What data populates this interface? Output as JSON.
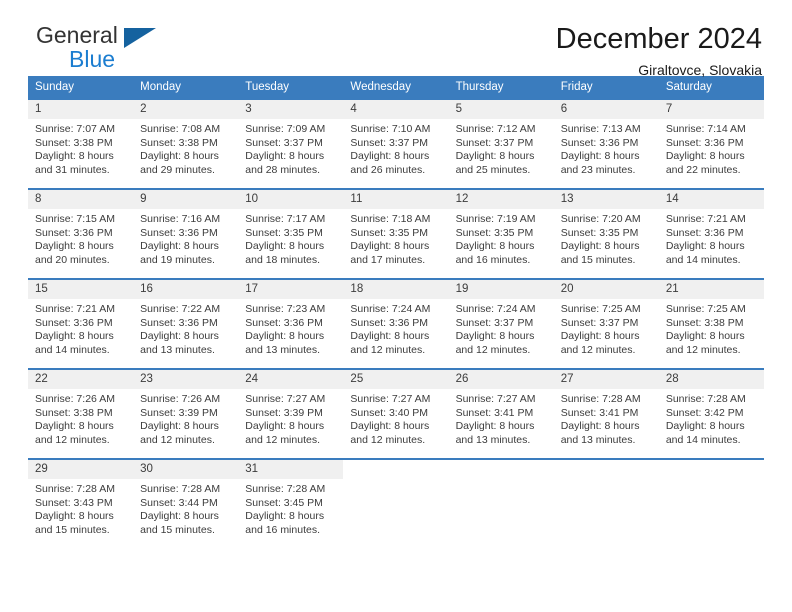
{
  "brand": {
    "name_top": "General",
    "name_bottom": "Blue",
    "mark": "triangle-logo"
  },
  "header": {
    "title": "December 2024",
    "subtitle": "Giraltovce, Slovakia"
  },
  "colors": {
    "header_blue": "#3a7cbe",
    "brand_blue": "#1b7dd0",
    "daynum_band": "#f0f0f0"
  },
  "weekday_headers": [
    "Sunday",
    "Monday",
    "Tuesday",
    "Wednesday",
    "Thursday",
    "Friday",
    "Saturday"
  ],
  "weeks": [
    [
      {
        "day": "1",
        "sunrise": "Sunrise: 7:07 AM",
        "sunset": "Sunset: 3:38 PM",
        "daylight_1": "Daylight: 8 hours",
        "daylight_2": "and 31 minutes."
      },
      {
        "day": "2",
        "sunrise": "Sunrise: 7:08 AM",
        "sunset": "Sunset: 3:38 PM",
        "daylight_1": "Daylight: 8 hours",
        "daylight_2": "and 29 minutes."
      },
      {
        "day": "3",
        "sunrise": "Sunrise: 7:09 AM",
        "sunset": "Sunset: 3:37 PM",
        "daylight_1": "Daylight: 8 hours",
        "daylight_2": "and 28 minutes."
      },
      {
        "day": "4",
        "sunrise": "Sunrise: 7:10 AM",
        "sunset": "Sunset: 3:37 PM",
        "daylight_1": "Daylight: 8 hours",
        "daylight_2": "and 26 minutes."
      },
      {
        "day": "5",
        "sunrise": "Sunrise: 7:12 AM",
        "sunset": "Sunset: 3:37 PM",
        "daylight_1": "Daylight: 8 hours",
        "daylight_2": "and 25 minutes."
      },
      {
        "day": "6",
        "sunrise": "Sunrise: 7:13 AM",
        "sunset": "Sunset: 3:36 PM",
        "daylight_1": "Daylight: 8 hours",
        "daylight_2": "and 23 minutes."
      },
      {
        "day": "7",
        "sunrise": "Sunrise: 7:14 AM",
        "sunset": "Sunset: 3:36 PM",
        "daylight_1": "Daylight: 8 hours",
        "daylight_2": "and 22 minutes."
      }
    ],
    [
      {
        "day": "8",
        "sunrise": "Sunrise: 7:15 AM",
        "sunset": "Sunset: 3:36 PM",
        "daylight_1": "Daylight: 8 hours",
        "daylight_2": "and 20 minutes."
      },
      {
        "day": "9",
        "sunrise": "Sunrise: 7:16 AM",
        "sunset": "Sunset: 3:36 PM",
        "daylight_1": "Daylight: 8 hours",
        "daylight_2": "and 19 minutes."
      },
      {
        "day": "10",
        "sunrise": "Sunrise: 7:17 AM",
        "sunset": "Sunset: 3:35 PM",
        "daylight_1": "Daylight: 8 hours",
        "daylight_2": "and 18 minutes."
      },
      {
        "day": "11",
        "sunrise": "Sunrise: 7:18 AM",
        "sunset": "Sunset: 3:35 PM",
        "daylight_1": "Daylight: 8 hours",
        "daylight_2": "and 17 minutes."
      },
      {
        "day": "12",
        "sunrise": "Sunrise: 7:19 AM",
        "sunset": "Sunset: 3:35 PM",
        "daylight_1": "Daylight: 8 hours",
        "daylight_2": "and 16 minutes."
      },
      {
        "day": "13",
        "sunrise": "Sunrise: 7:20 AM",
        "sunset": "Sunset: 3:35 PM",
        "daylight_1": "Daylight: 8 hours",
        "daylight_2": "and 15 minutes."
      },
      {
        "day": "14",
        "sunrise": "Sunrise: 7:21 AM",
        "sunset": "Sunset: 3:36 PM",
        "daylight_1": "Daylight: 8 hours",
        "daylight_2": "and 14 minutes."
      }
    ],
    [
      {
        "day": "15",
        "sunrise": "Sunrise: 7:21 AM",
        "sunset": "Sunset: 3:36 PM",
        "daylight_1": "Daylight: 8 hours",
        "daylight_2": "and 14 minutes."
      },
      {
        "day": "16",
        "sunrise": "Sunrise: 7:22 AM",
        "sunset": "Sunset: 3:36 PM",
        "daylight_1": "Daylight: 8 hours",
        "daylight_2": "and 13 minutes."
      },
      {
        "day": "17",
        "sunrise": "Sunrise: 7:23 AM",
        "sunset": "Sunset: 3:36 PM",
        "daylight_1": "Daylight: 8 hours",
        "daylight_2": "and 13 minutes."
      },
      {
        "day": "18",
        "sunrise": "Sunrise: 7:24 AM",
        "sunset": "Sunset: 3:36 PM",
        "daylight_1": "Daylight: 8 hours",
        "daylight_2": "and 12 minutes."
      },
      {
        "day": "19",
        "sunrise": "Sunrise: 7:24 AM",
        "sunset": "Sunset: 3:37 PM",
        "daylight_1": "Daylight: 8 hours",
        "daylight_2": "and 12 minutes."
      },
      {
        "day": "20",
        "sunrise": "Sunrise: 7:25 AM",
        "sunset": "Sunset: 3:37 PM",
        "daylight_1": "Daylight: 8 hours",
        "daylight_2": "and 12 minutes."
      },
      {
        "day": "21",
        "sunrise": "Sunrise: 7:25 AM",
        "sunset": "Sunset: 3:38 PM",
        "daylight_1": "Daylight: 8 hours",
        "daylight_2": "and 12 minutes."
      }
    ],
    [
      {
        "day": "22",
        "sunrise": "Sunrise: 7:26 AM",
        "sunset": "Sunset: 3:38 PM",
        "daylight_1": "Daylight: 8 hours",
        "daylight_2": "and 12 minutes."
      },
      {
        "day": "23",
        "sunrise": "Sunrise: 7:26 AM",
        "sunset": "Sunset: 3:39 PM",
        "daylight_1": "Daylight: 8 hours",
        "daylight_2": "and 12 minutes."
      },
      {
        "day": "24",
        "sunrise": "Sunrise: 7:27 AM",
        "sunset": "Sunset: 3:39 PM",
        "daylight_1": "Daylight: 8 hours",
        "daylight_2": "and 12 minutes."
      },
      {
        "day": "25",
        "sunrise": "Sunrise: 7:27 AM",
        "sunset": "Sunset: 3:40 PM",
        "daylight_1": "Daylight: 8 hours",
        "daylight_2": "and 12 minutes."
      },
      {
        "day": "26",
        "sunrise": "Sunrise: 7:27 AM",
        "sunset": "Sunset: 3:41 PM",
        "daylight_1": "Daylight: 8 hours",
        "daylight_2": "and 13 minutes."
      },
      {
        "day": "27",
        "sunrise": "Sunrise: 7:28 AM",
        "sunset": "Sunset: 3:41 PM",
        "daylight_1": "Daylight: 8 hours",
        "daylight_2": "and 13 minutes."
      },
      {
        "day": "28",
        "sunrise": "Sunrise: 7:28 AM",
        "sunset": "Sunset: 3:42 PM",
        "daylight_1": "Daylight: 8 hours",
        "daylight_2": "and 14 minutes."
      }
    ],
    [
      {
        "day": "29",
        "sunrise": "Sunrise: 7:28 AM",
        "sunset": "Sunset: 3:43 PM",
        "daylight_1": "Daylight: 8 hours",
        "daylight_2": "and 15 minutes."
      },
      {
        "day": "30",
        "sunrise": "Sunrise: 7:28 AM",
        "sunset": "Sunset: 3:44 PM",
        "daylight_1": "Daylight: 8 hours",
        "daylight_2": "and 15 minutes."
      },
      {
        "day": "31",
        "sunrise": "Sunrise: 7:28 AM",
        "sunset": "Sunset: 3:45 PM",
        "daylight_1": "Daylight: 8 hours",
        "daylight_2": "and 16 minutes."
      },
      {
        "day": "",
        "sunrise": "",
        "sunset": "",
        "daylight_1": "",
        "daylight_2": ""
      },
      {
        "day": "",
        "sunrise": "",
        "sunset": "",
        "daylight_1": "",
        "daylight_2": ""
      },
      {
        "day": "",
        "sunrise": "",
        "sunset": "",
        "daylight_1": "",
        "daylight_2": ""
      },
      {
        "day": "",
        "sunrise": "",
        "sunset": "",
        "daylight_1": "",
        "daylight_2": ""
      }
    ]
  ]
}
